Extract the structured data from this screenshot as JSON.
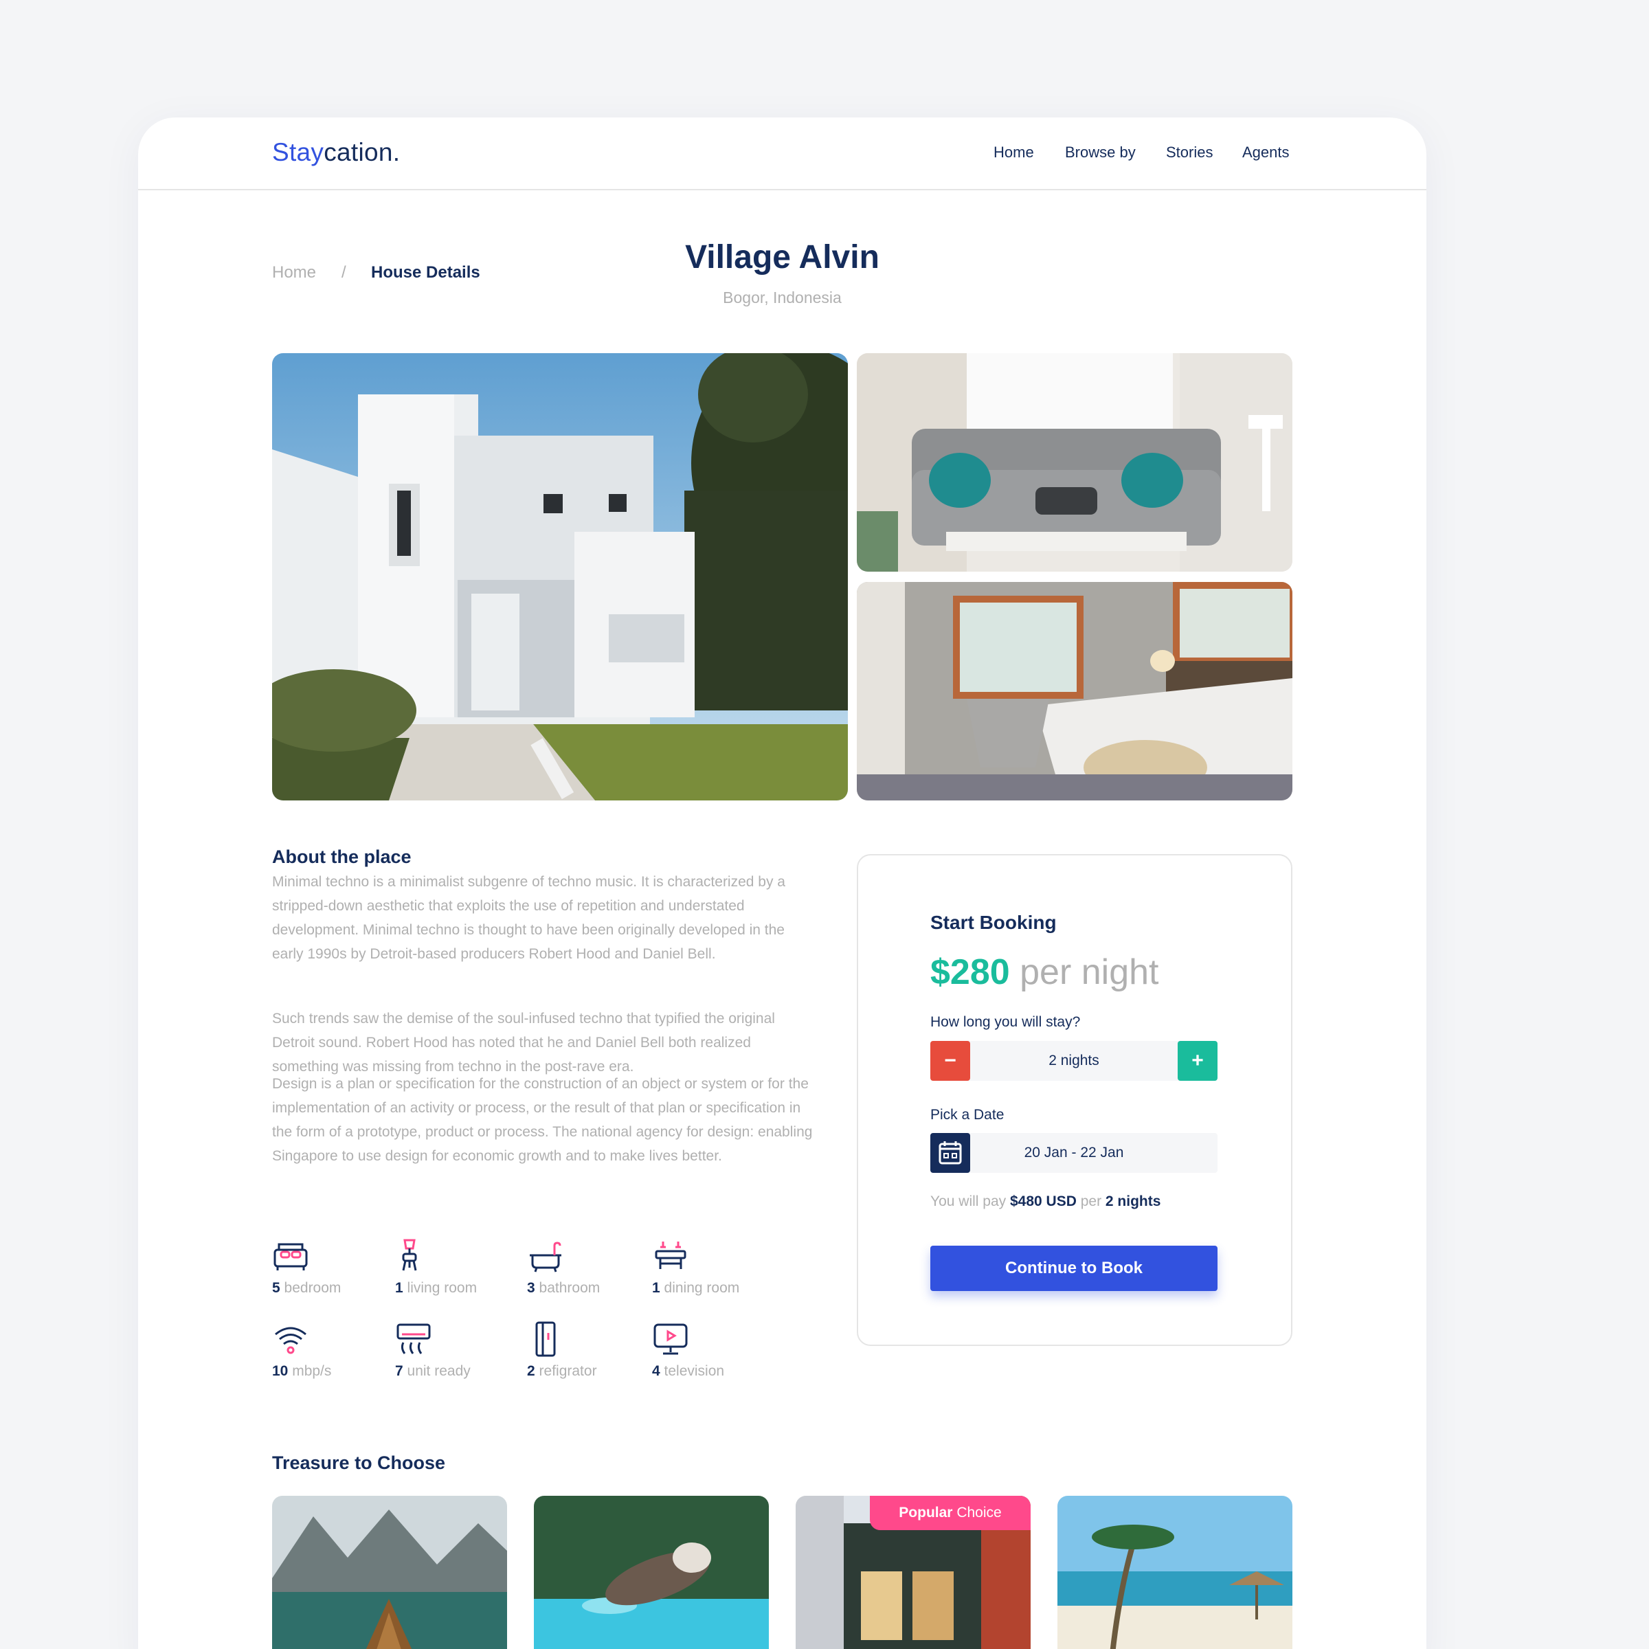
{
  "brand": {
    "accent": "Stay",
    "rest": "cation."
  },
  "nav": {
    "home": "Home",
    "browse": "Browse by",
    "stories": "Stories",
    "agents": "Agents"
  },
  "breadcrumb": {
    "home": "Home",
    "separator": "/",
    "current": "House Details"
  },
  "property": {
    "title": "Village Alvin",
    "location": "Bogor, Indonesia"
  },
  "gallery": {
    "images": [
      "white-house-exterior",
      "living-room-sofa",
      "bedroom"
    ]
  },
  "about": {
    "heading": "About the place",
    "paragraphs": [
      "Minimal techno is a minimalist subgenre of techno music. It is characterized by a stripped-down aesthetic that exploits the use of repetition and understated development. Minimal techno is thought to have been originally developed in the early 1990s by Detroit-based producers Robert Hood and Daniel Bell.",
      "Such trends saw the demise of the soul-infused techno that typified the original Detroit sound. Robert Hood has noted that he and Daniel Bell both realized something was missing from techno in the post-rave era.",
      "Design is a plan or specification for the construction of an object or system or for the implementation of an activity or process, or the result of that plan or specification in the form of a prototype, product or process. The national agency for design: enabling Singapore to use design for economic growth and to make lives better."
    ]
  },
  "features": [
    {
      "icon": "bed-icon",
      "count": "5",
      "label": "bedroom"
    },
    {
      "icon": "lamp-icon",
      "count": "1",
      "label": "living room"
    },
    {
      "icon": "bathtub-icon",
      "count": "3",
      "label": "bathroom"
    },
    {
      "icon": "dining-table-icon",
      "count": "1",
      "label": "dining room"
    },
    {
      "icon": "wifi-icon",
      "count": "10",
      "label": "mbp/s"
    },
    {
      "icon": "air-conditioner-icon",
      "count": "7",
      "label": "unit ready"
    },
    {
      "icon": "refrigerator-icon",
      "count": "2",
      "label": "refigrator"
    },
    {
      "icon": "television-icon",
      "count": "4",
      "label": "television"
    }
  ],
  "booking": {
    "title": "Start Booking",
    "price": "$280",
    "per": "per night",
    "duration_label": "How long you will stay?",
    "minus": "−",
    "plus": "+",
    "duration_value": "2 nights",
    "date_label": "Pick a Date",
    "date_value": "20 Jan - 22 Jan",
    "pay_prefix": "You will pay",
    "pay_amount": "$480 USD",
    "pay_per": "per",
    "pay_nights": "2 nights",
    "cta": "Continue to Book"
  },
  "treasures": {
    "heading": "Treasure to Choose",
    "badge_bold": "Popular",
    "badge_rest": "Choice",
    "tiles": [
      "mountain-lake",
      "dog-pool",
      "storefront",
      "beach-palm"
    ]
  },
  "colors": {
    "primary": "#3252df",
    "navy": "#152c5b",
    "green": "#1abc9c",
    "red": "#e74c3c",
    "pink": "#ff498b",
    "gray": "#b0b0b0"
  }
}
